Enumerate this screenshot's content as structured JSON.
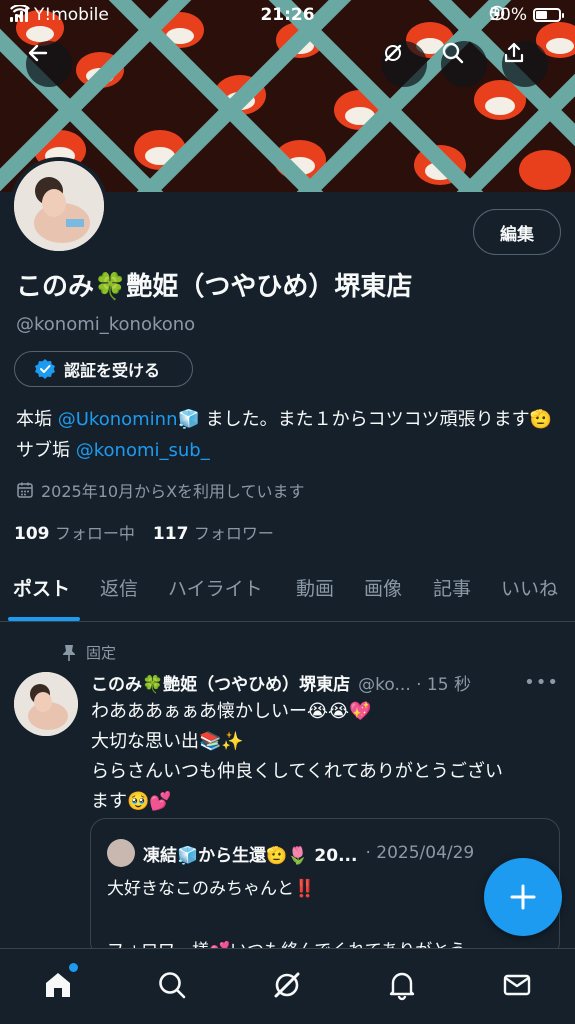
{
  "status_bar": {
    "carrier": "Y!mobile",
    "time": "21:26",
    "battery": "50%"
  },
  "profile": {
    "display_name": "このみ🍀艶姫（つやひめ）堺東店",
    "handle": "@konomi_konokono",
    "edit_label": "編集",
    "verify_label": "認証を受ける",
    "bio_part1": "本垢 ",
    "bio_mention1": "@Ukonominn",
    "bio_part2": "🧊 ました。また１からコツコツ頑張ります🫡 サブ垢 ",
    "bio_mention2": "@konomi_sub_",
    "joined": "2025年10月からXを利用しています",
    "following_count": "109",
    "following_label": "フォロー中",
    "followers_count": "117",
    "followers_label": "フォロワー"
  },
  "tabs": [
    "ポスト",
    "返信",
    "ハイライト",
    "動画",
    "画像",
    "記事",
    "いいね"
  ],
  "tweet": {
    "pinned_label": "固定",
    "name": "このみ🍀艶姫（つやひめ）堺東店",
    "meta": "@ko... · 15 秒",
    "line1": "わあああぁぁあ懐かしいー😭😭💖",
    "line2": "大切な思い出📚✨",
    "line3": "ららさんいつも仲良くしてくれてありがとうござい",
    "line4": "ます🥹💕"
  },
  "quote": {
    "name": "凍結🧊から生還🫡🌷 20...",
    "date": "· 2025/04/29",
    "line1": "大好きなこのみちゃんと‼️",
    "line2": "",
    "line3": "フォロワー様💕いつも絡んでくれてありがとう"
  },
  "colors": {
    "background": "#15202b",
    "accent": "#1d9bf0",
    "secondary_text": "#8b98a5",
    "border": "#38444d"
  },
  "icons": [
    "back-arrow-icon",
    "grok-icon",
    "search-icon",
    "share-icon",
    "verified-badge-icon",
    "calendar-icon",
    "pin-icon",
    "more-icon",
    "compose-plus-icon",
    "home-icon",
    "explore-icon",
    "grok-nav-icon",
    "notifications-icon",
    "messages-icon"
  ]
}
